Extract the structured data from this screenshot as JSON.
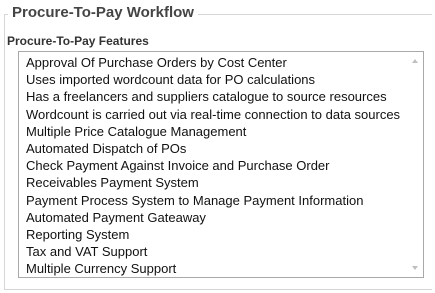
{
  "workflow": {
    "title": "Procure-To-Pay Workflow",
    "features_label": "Procure-To-Pay Features",
    "features": [
      "Approval Of Purchase Orders by Cost Center",
      "Uses imported wordcount data for PO calculations",
      "Has a freelancers and suppliers catalogue to source resources",
      "Wordcount is carried out via real-time connection to data sources",
      "Multiple Price Catalogue Management",
      "Automated Dispatch of POs",
      "Check Payment Against Invoice and Purchase Order",
      "Receivables Payment System",
      "Payment Process System to Manage Payment Information",
      "Automated Payment Gateaway",
      "Reporting System",
      "Tax and VAT Support",
      "Multiple Currency Support"
    ]
  },
  "icons": {
    "scroll_up": "chevron-up-icon",
    "scroll_down": "chevron-down-icon"
  }
}
